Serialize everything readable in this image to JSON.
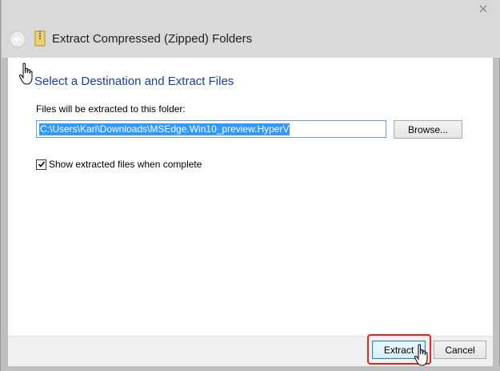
{
  "window": {
    "title": "Extract Compressed (Zipped) Folders",
    "close_icon": "close-icon",
    "back_icon": "back-arrow-icon",
    "folder_icon": "zipped-folder-icon"
  },
  "dialog": {
    "heading": "Select a Destination and Extract Files",
    "destination_label": "Files will be extracted to this folder:",
    "destination_value": "C:\\Users\\Kari\\Downloads\\MSEdge.Win10_preview.HyperV",
    "browse_label": "Browse...",
    "show_files_label": "Show extracted files when complete",
    "show_files_checked": true
  },
  "footer": {
    "extract_label": "Extract",
    "cancel_label": "Cancel"
  },
  "colors": {
    "heading": "#1a3e9a",
    "selection": "#3399ff",
    "highlight_ring": "#e0242a"
  }
}
